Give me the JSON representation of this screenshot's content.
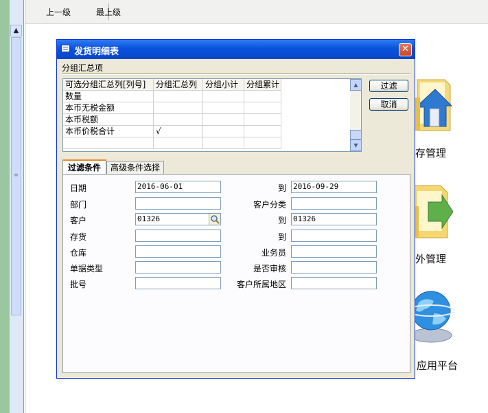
{
  "toolbar": {
    "parent_label": "上一级",
    "top_label": "最上级"
  },
  "launchers": {
    "inventory": "存管理",
    "outsourcing": "外管理",
    "platform": "应用平台"
  },
  "dialog": {
    "title": "发货明细表",
    "close_symbol": "✕",
    "group_label": "分组汇总项",
    "grid": {
      "columns": [
        "可选分组汇总列[列号]",
        "分组汇总列",
        "分组小计",
        "分组累计"
      ],
      "rows": [
        [
          "数量",
          "",
          "",
          ""
        ],
        [
          "本币无税金额",
          "",
          "",
          ""
        ],
        [
          "本币税额",
          "",
          "",
          ""
        ],
        [
          "本币价税合计",
          "√",
          "",
          ""
        ],
        [
          "",
          "",
          "",
          ""
        ]
      ],
      "scroll_up": "▲",
      "scroll_down": "▼"
    },
    "buttons": {
      "filter": "过滤",
      "cancel": "取消"
    },
    "tabs": [
      "过滤条件",
      "高级条件选择"
    ],
    "form": {
      "date_label": "日期",
      "date_from": "2016-06-01",
      "to1_label": "到",
      "date_to": "2016-09-29",
      "dept_label": "部门",
      "dept_value": "",
      "custcat_label": "客户分类",
      "custcat_value": "",
      "cust_label": "客户",
      "cust_from": "01326",
      "to2_label": "到",
      "cust_to": "01326",
      "stock_label": "存货",
      "stock_from": "",
      "to3_label": "到",
      "stock_to": "",
      "wh_label": "仓库",
      "wh_value": "",
      "sales_label": "业务员",
      "sales_value": "",
      "doctype_label": "单据类型",
      "doctype_value": "",
      "audit_label": "是否审核",
      "audit_value": "",
      "batch_label": "批号",
      "batch_value": "",
      "region_label": "客户所属地区",
      "region_value": ""
    }
  }
}
